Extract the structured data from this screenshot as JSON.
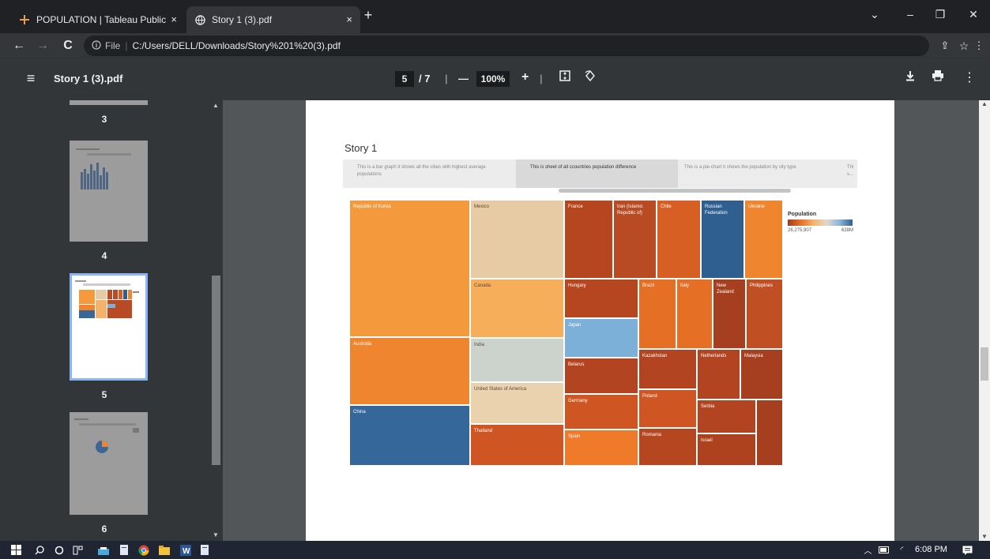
{
  "browser": {
    "tabs": [
      {
        "label": "POPULATION | Tableau Public",
        "close": "×",
        "active": false
      },
      {
        "label": "Story 1 (3).pdf",
        "close": "×",
        "active": true
      }
    ],
    "new_tab": "+",
    "window_controls": {
      "dropdown": "⌄",
      "minimize": "–",
      "restore": "❐",
      "close": "✕"
    },
    "address": {
      "scheme": "File",
      "url": "C:/Users/DELL/Downloads/Story%201%20(3).pdf"
    },
    "nav": {
      "back": "←",
      "forward": "→",
      "reload": "C"
    }
  },
  "pdf_toolbar": {
    "title": "Story 1 (3).pdf",
    "current_page": "5",
    "total_pages": "/ 7",
    "zoom": "100%",
    "zoom_out": "—",
    "zoom_in": "+"
  },
  "sidebar": {
    "pages": [
      {
        "label": "3"
      },
      {
        "label": "4"
      },
      {
        "label": "5"
      },
      {
        "label": "6"
      }
    ]
  },
  "story": {
    "title": "Story 1",
    "tabs": [
      {
        "text": "This is a bar graph it shows all the cities with highest average populations"
      },
      {
        "text": "This is sheet of all ccountries population difference"
      },
      {
        "text": "This is a pie-chart it shows the population by city type"
      },
      {
        "text": "Thi s..."
      }
    ],
    "legend": {
      "title": "Population",
      "min": "26,275,907",
      "max": "628M"
    }
  },
  "chart_data": {
    "type": "treemap",
    "title": "",
    "color_legend": {
      "title": "Population",
      "min": "26,275,907",
      "max": "628M"
    },
    "items": [
      {
        "label": "Republic of Korea"
      },
      {
        "label": "Mexico"
      },
      {
        "label": "France"
      },
      {
        "label": "Iran (Islamic Republic of)"
      },
      {
        "label": "Chile"
      },
      {
        "label": "Russian Federation"
      },
      {
        "label": "Ukraine"
      },
      {
        "label": "Canada"
      },
      {
        "label": "Hungary"
      },
      {
        "label": "Brazil"
      },
      {
        "label": "Italy"
      },
      {
        "label": "New Zealand"
      },
      {
        "label": "Philippines"
      },
      {
        "label": "Japan"
      },
      {
        "label": "Australia"
      },
      {
        "label": "India"
      },
      {
        "label": "Belarus"
      },
      {
        "label": "Kazakhstan"
      },
      {
        "label": "Netherlands"
      },
      {
        "label": "Malaysia"
      },
      {
        "label": "United States of America"
      },
      {
        "label": "Germany"
      },
      {
        "label": "Poland"
      },
      {
        "label": "Serbia"
      },
      {
        "label": "China"
      },
      {
        "label": "Thailand"
      },
      {
        "label": "Spain"
      },
      {
        "label": "Romania"
      },
      {
        "label": "Israel"
      }
    ]
  },
  "taskbar": {
    "time": "6:08 PM"
  }
}
